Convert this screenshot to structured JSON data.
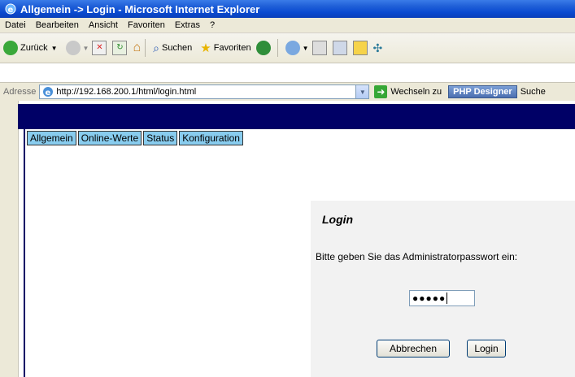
{
  "window": {
    "title": "Allgemein -> Login - Microsoft Internet Explorer"
  },
  "menu": [
    "Datei",
    "Bearbeiten",
    "Ansicht",
    "Favoriten",
    "Extras",
    "?"
  ],
  "toolbar": {
    "back_label": "Zurück",
    "search_label": "Suchen",
    "favorites_label": "Favoriten"
  },
  "address": {
    "label": "Adresse",
    "url": "http://192.168.200.1/html/login.html",
    "go_label": "Wechseln zu",
    "php_designer": "PHP Designer",
    "search_trailing": "Suche"
  },
  "tabs": [
    "Allgemein",
    "Online-Werte",
    "Status",
    "Konfiguration"
  ],
  "login": {
    "heading": "Login",
    "prompt": "Bitte geben Sie das Administratorpasswort ein:",
    "password_masked": "●●●●●",
    "cancel_label": "Abbrechen",
    "login_label": "Login"
  }
}
